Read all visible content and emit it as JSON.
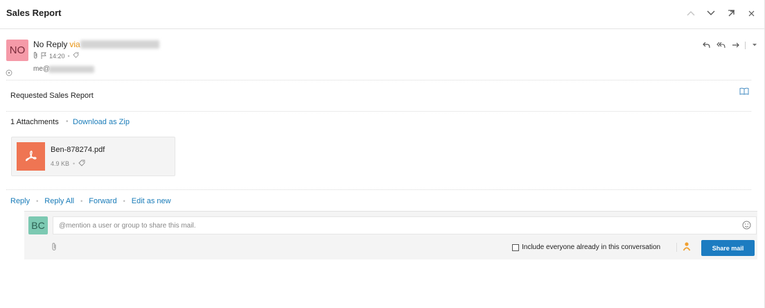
{
  "header": {
    "title": "Sales Report",
    "icons": [
      "chevron-up-icon",
      "chevron-down-icon",
      "popout-icon",
      "close-icon"
    ]
  },
  "message": {
    "avatar_initials": "NO",
    "sender_name": "No Reply",
    "via_label": "via",
    "time": "14:20",
    "to_prefix": "me@",
    "body": "Requested Sales Report"
  },
  "attachments": {
    "count_label": "1 Attachments",
    "download_zip_label": "Download as Zip",
    "file": {
      "name": "Ben-878274.pdf",
      "size": "4.9 KB"
    }
  },
  "actions": {
    "reply": "Reply",
    "reply_all": "Reply All",
    "forward": "Forward",
    "edit_as_new": "Edit as new"
  },
  "share": {
    "avatar_initials": "BC",
    "placeholder": "@mention a user or group to share this mail.",
    "include_label": "Include everyone already in this conversation",
    "share_button": "Share mail"
  },
  "colors": {
    "link": "#1a7cb9",
    "via": "#e8910c",
    "pdf": "#ef7553",
    "avatar_sender": "#f59aa8",
    "avatar_user": "#7cc9b2",
    "share_button": "#1c7cc1"
  }
}
